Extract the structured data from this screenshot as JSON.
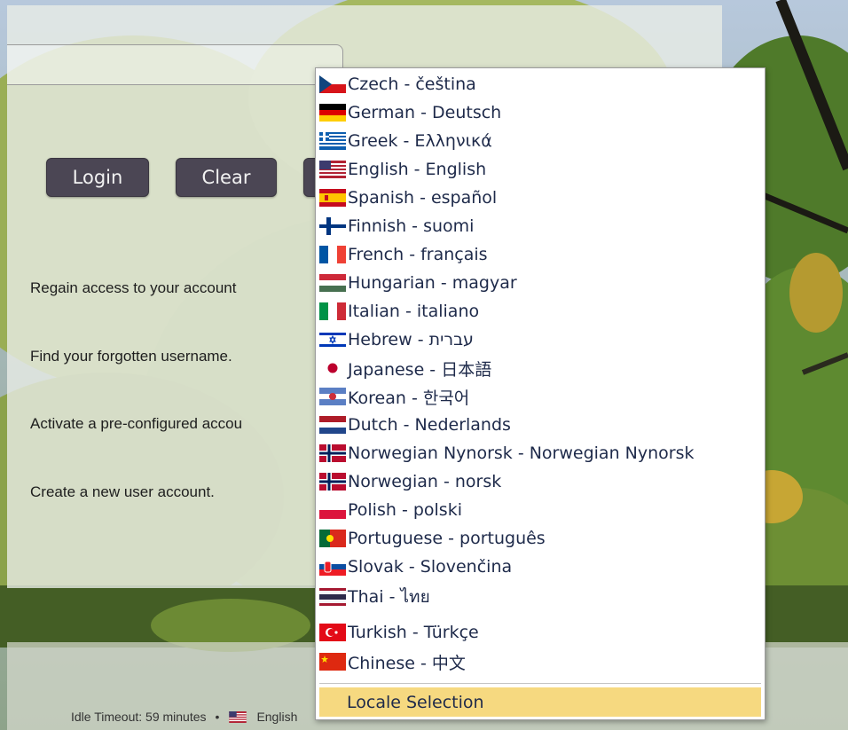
{
  "buttons": {
    "login": "Login",
    "clear": "Clear"
  },
  "links": {
    "regain": "Regain access to your account",
    "forgot_username": "Find your forgotten username.",
    "activate": "Activate a pre-configured accou",
    "create": "Create a new user account."
  },
  "status_bar": {
    "idle_timeout": "Idle Timeout: 59 minutes",
    "separator": "•",
    "current_locale": "English"
  },
  "locale_menu": {
    "items": [
      {
        "label": "Czech - čeština",
        "flag": "flag-cz-icon"
      },
      {
        "label": "German - Deutsch",
        "flag": "flag-de-icon"
      },
      {
        "label": "Greek - Ελληνικά",
        "flag": "flag-gr-icon"
      },
      {
        "label": "English - English",
        "flag": "flag-us-icon"
      },
      {
        "label": "Spanish - español",
        "flag": "flag-es-icon"
      },
      {
        "label": "Finnish - suomi",
        "flag": "flag-fi-icon"
      },
      {
        "label": "French - français",
        "flag": "flag-fr-icon"
      },
      {
        "label": "Hungarian - magyar",
        "flag": "flag-hu-icon"
      },
      {
        "label": "Italian - italiano",
        "flag": "flag-it-icon"
      },
      {
        "label": "Hebrew - עברית",
        "flag": "flag-il-icon"
      },
      {
        "label": "Japanese - 日本語",
        "flag": "flag-jp-icon"
      },
      {
        "label": "Korean - 한국어",
        "flag": "flag-kr-icon"
      },
      {
        "label": "Dutch - Nederlands",
        "flag": "flag-nl-icon"
      },
      {
        "label": "Norwegian Nynorsk - Norwegian Nynorsk",
        "flag": "flag-no-icon"
      },
      {
        "label": "Norwegian - norsk",
        "flag": "flag-no-icon"
      },
      {
        "label": "Polish - polski",
        "flag": "flag-pl-icon"
      },
      {
        "label": "Portuguese - português",
        "flag": "flag-pt-icon"
      },
      {
        "label": "Slovak - Slovenčina",
        "flag": "flag-sk-icon"
      },
      {
        "label": "Thai - ไทย",
        "flag": "flag-th-icon"
      },
      {
        "label": "Turkish - Türkçe",
        "flag": "flag-tr-icon"
      },
      {
        "label": "Chinese - 中文",
        "flag": "flag-cn-icon"
      }
    ],
    "footer_label": "Locale Selection"
  },
  "colors": {
    "button_bg": "#4b4654",
    "menu_highlight": "#f6d980",
    "menu_text": "#1e2a4a"
  }
}
